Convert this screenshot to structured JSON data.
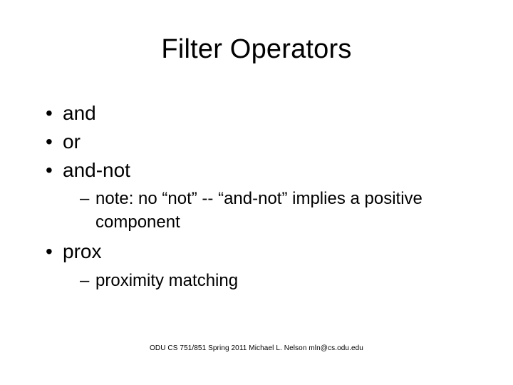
{
  "title": "Filter Operators",
  "bullets": {
    "b1": "and",
    "b2": "or",
    "b3": "and-not",
    "b3_sub": "note: no “not” -- “and-not” implies a positive component",
    "b4": "prox",
    "b4_sub": "proximity matching"
  },
  "footer": "ODU CS 751/851 Spring 2011 Michael L. Nelson mln@cs.odu.edu"
}
